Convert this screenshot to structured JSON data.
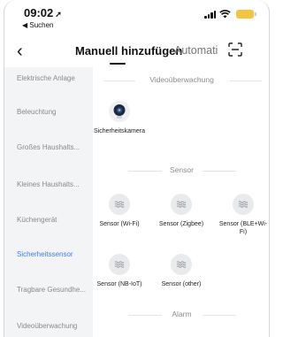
{
  "status_bar": {
    "time": "09:02",
    "back_app": "◀ Suchen"
  },
  "nav": {
    "tab_manual": "Manuell hinzufügen",
    "tab_auto": "Automatis"
  },
  "sidebar": {
    "items": [
      {
        "label": "Elektrische Anlage",
        "active": false
      },
      {
        "label": "Beleuchtung",
        "active": false
      },
      {
        "label": "Großes Haushalts...",
        "active": false
      },
      {
        "label": "Kleines Haushalts...",
        "active": false
      },
      {
        "label": "Küchengerät",
        "active": false
      },
      {
        "label": "Sicherheitssensor",
        "active": true
      },
      {
        "label": "Tragbare Gesundhe...",
        "active": false
      },
      {
        "label": "Videoüberwachung",
        "active": false
      }
    ]
  },
  "sections": {
    "video": {
      "title": "Videoüberwachung",
      "devices": [
        {
          "label": "Sicherheitskamera",
          "icon": "camera-icon"
        }
      ]
    },
    "sensor": {
      "title": "Sensor",
      "devices": [
        {
          "label": "Sensor (Wi-Fi)",
          "icon": "sensor-wave-icon"
        },
        {
          "label": "Sensor (Zigbee)",
          "icon": "sensor-wave-icon"
        },
        {
          "label": "Sensor (BLE+Wi-Fi)",
          "icon": "sensor-wave-icon"
        },
        {
          "label": "Sensor (NB-IoT)",
          "icon": "sensor-wave-icon"
        },
        {
          "label": "Sensor (other)",
          "icon": "sensor-wave-icon"
        }
      ]
    },
    "alarm": {
      "title": "Alarm"
    }
  },
  "colors": {
    "active": "#3c7ef0",
    "sidebar_bg": "#f3f4f6",
    "battery": "#f4c542"
  }
}
